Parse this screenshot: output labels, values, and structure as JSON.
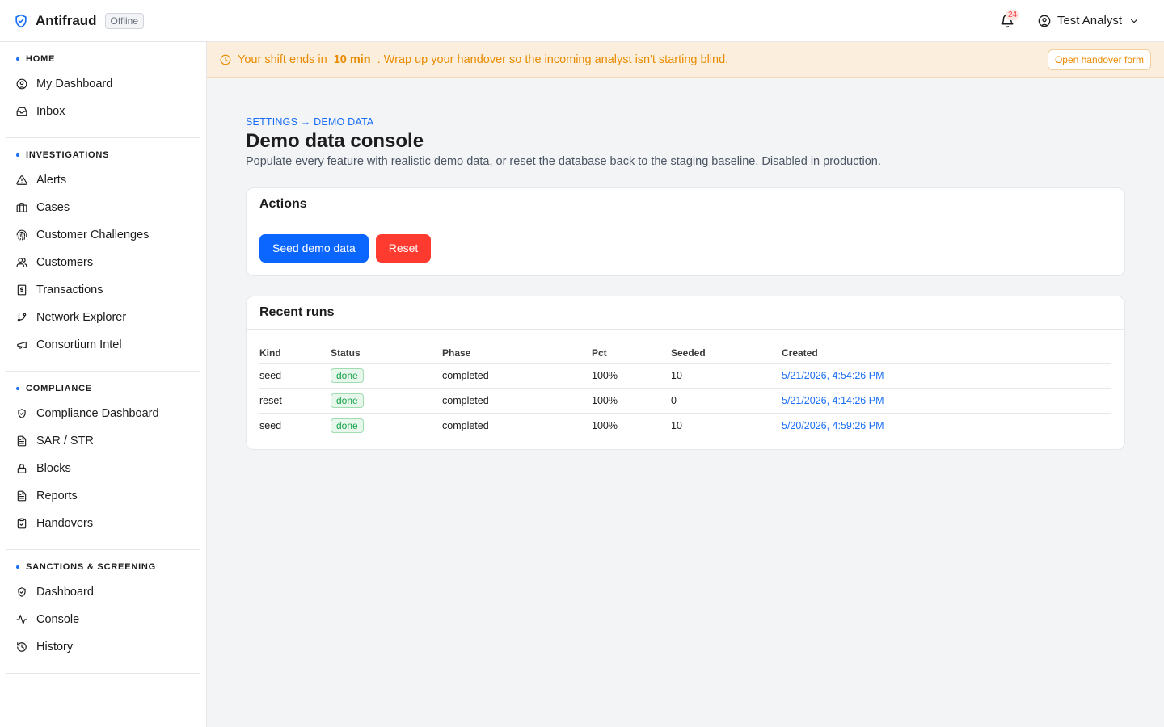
{
  "app": {
    "name": "Antifraud",
    "status": "Offline"
  },
  "header": {
    "notifications_count": "24",
    "user_name": "Test Analyst"
  },
  "sidebar": {
    "sections": [
      {
        "title": "HOME",
        "items": [
          {
            "label": "My Dashboard",
            "icon": "user-circle-icon"
          },
          {
            "label": "Inbox",
            "icon": "inbox-icon"
          }
        ]
      },
      {
        "title": "INVESTIGATIONS",
        "items": [
          {
            "label": "Alerts",
            "icon": "alert-triangle-icon"
          },
          {
            "label": "Cases",
            "icon": "briefcase-icon"
          },
          {
            "label": "Customer Challenges",
            "icon": "fingerprint-icon"
          },
          {
            "label": "Customers",
            "icon": "users-icon"
          },
          {
            "label": "Transactions",
            "icon": "receipt-icon"
          },
          {
            "label": "Network Explorer",
            "icon": "git-branch-icon"
          },
          {
            "label": "Consortium Intel",
            "icon": "megaphone-icon"
          }
        ]
      },
      {
        "title": "COMPLIANCE",
        "items": [
          {
            "label": "Compliance Dashboard",
            "icon": "shield-check-icon"
          },
          {
            "label": "SAR / STR",
            "icon": "file-text-icon"
          },
          {
            "label": "Blocks",
            "icon": "lock-icon"
          },
          {
            "label": "Reports",
            "icon": "file-text-icon"
          },
          {
            "label": "Handovers",
            "icon": "clipboard-check-icon"
          }
        ]
      },
      {
        "title": "SANCTIONS & SCREENING",
        "items": [
          {
            "label": "Dashboard",
            "icon": "shield-check-icon"
          },
          {
            "label": "Console",
            "icon": "activity-icon"
          },
          {
            "label": "History",
            "icon": "history-icon"
          }
        ]
      }
    ]
  },
  "banner": {
    "prefix": "Your shift ends in",
    "time": "10 min",
    "suffix": ". Wrap up your handover so the incoming analyst isn't starting blind.",
    "button": "Open handover form"
  },
  "page": {
    "breadcrumb": "SETTINGS → DEMO DATA",
    "title": "Demo data console",
    "description": "Populate every feature with realistic demo data, or reset the database back to the staging baseline. Disabled in production."
  },
  "actions": {
    "title": "Actions",
    "seed_label": "Seed demo data",
    "reset_label": "Reset"
  },
  "runs": {
    "title": "Recent runs",
    "columns": [
      "Kind",
      "Status",
      "Phase",
      "Pct",
      "Seeded",
      "Created"
    ],
    "rows": [
      {
        "kind": "seed",
        "status": "done",
        "phase": "completed",
        "pct": "100%",
        "seeded": "10",
        "created": "5/21/2026, 4:54:26 PM"
      },
      {
        "kind": "reset",
        "status": "done",
        "phase": "completed",
        "pct": "100%",
        "seeded": "0",
        "created": "5/21/2026, 4:14:26 PM"
      },
      {
        "kind": "seed",
        "status": "done",
        "phase": "completed",
        "pct": "100%",
        "seeded": "10",
        "created": "5/20/2026, 4:59:26 PM"
      }
    ]
  },
  "colors": {
    "accent": "#0a66ff",
    "danger": "#ff3b30",
    "warning": "#e98b00",
    "success": "#16a34a"
  }
}
